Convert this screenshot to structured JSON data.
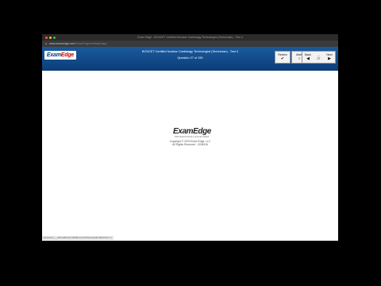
{
  "window": {
    "title": "Exam Edge - BCNCET Certified Nuclear Cardiology Technologist (Technician) - Test 4",
    "url_domain": "www.examedge.com",
    "url_path": "/ExamEngine/default.aspx"
  },
  "header": {
    "logo_exam": "Exam",
    "logo_edge": "Edge",
    "exam_title": "BCNCET Certified Nuclear Cardiology Technologist (Technician) - Test 4",
    "question_counter": "Question 27 of 150",
    "font_size_label": "Font Size",
    "font_size_value": "Small"
  },
  "toolbar": {
    "review_label": "Review",
    "review_icon": "checkmark-icon",
    "mark_label": "Mark",
    "mark_icon": "circle-icon",
    "back_label": "Back",
    "back_icon": "arrow-left-icon",
    "question_number": "27",
    "next_label": "Next",
    "next_icon": "arrow-right-icon"
  },
  "main": {
    "logo_exam": "Exam",
    "logo_edge": "Edge",
    "logo_tagline": "PROFESSIONAL EXAM PREP",
    "copyright_line1": "Copyright © 2023 Exam Edge, LLC",
    "copyright_line2": "All Rights Reserved - 0034516"
  },
  "status": {
    "text": "javascript:__doPostBack('ctl00$ContentPlaceHolder1$lnkNext','')"
  },
  "colors": {
    "header_blue": "#0c3d78",
    "logo_red": "#cc0000",
    "close_dot": "#ff5f57",
    "minimize_dot": "#febc2e",
    "zoom_dot": "#28c840"
  }
}
